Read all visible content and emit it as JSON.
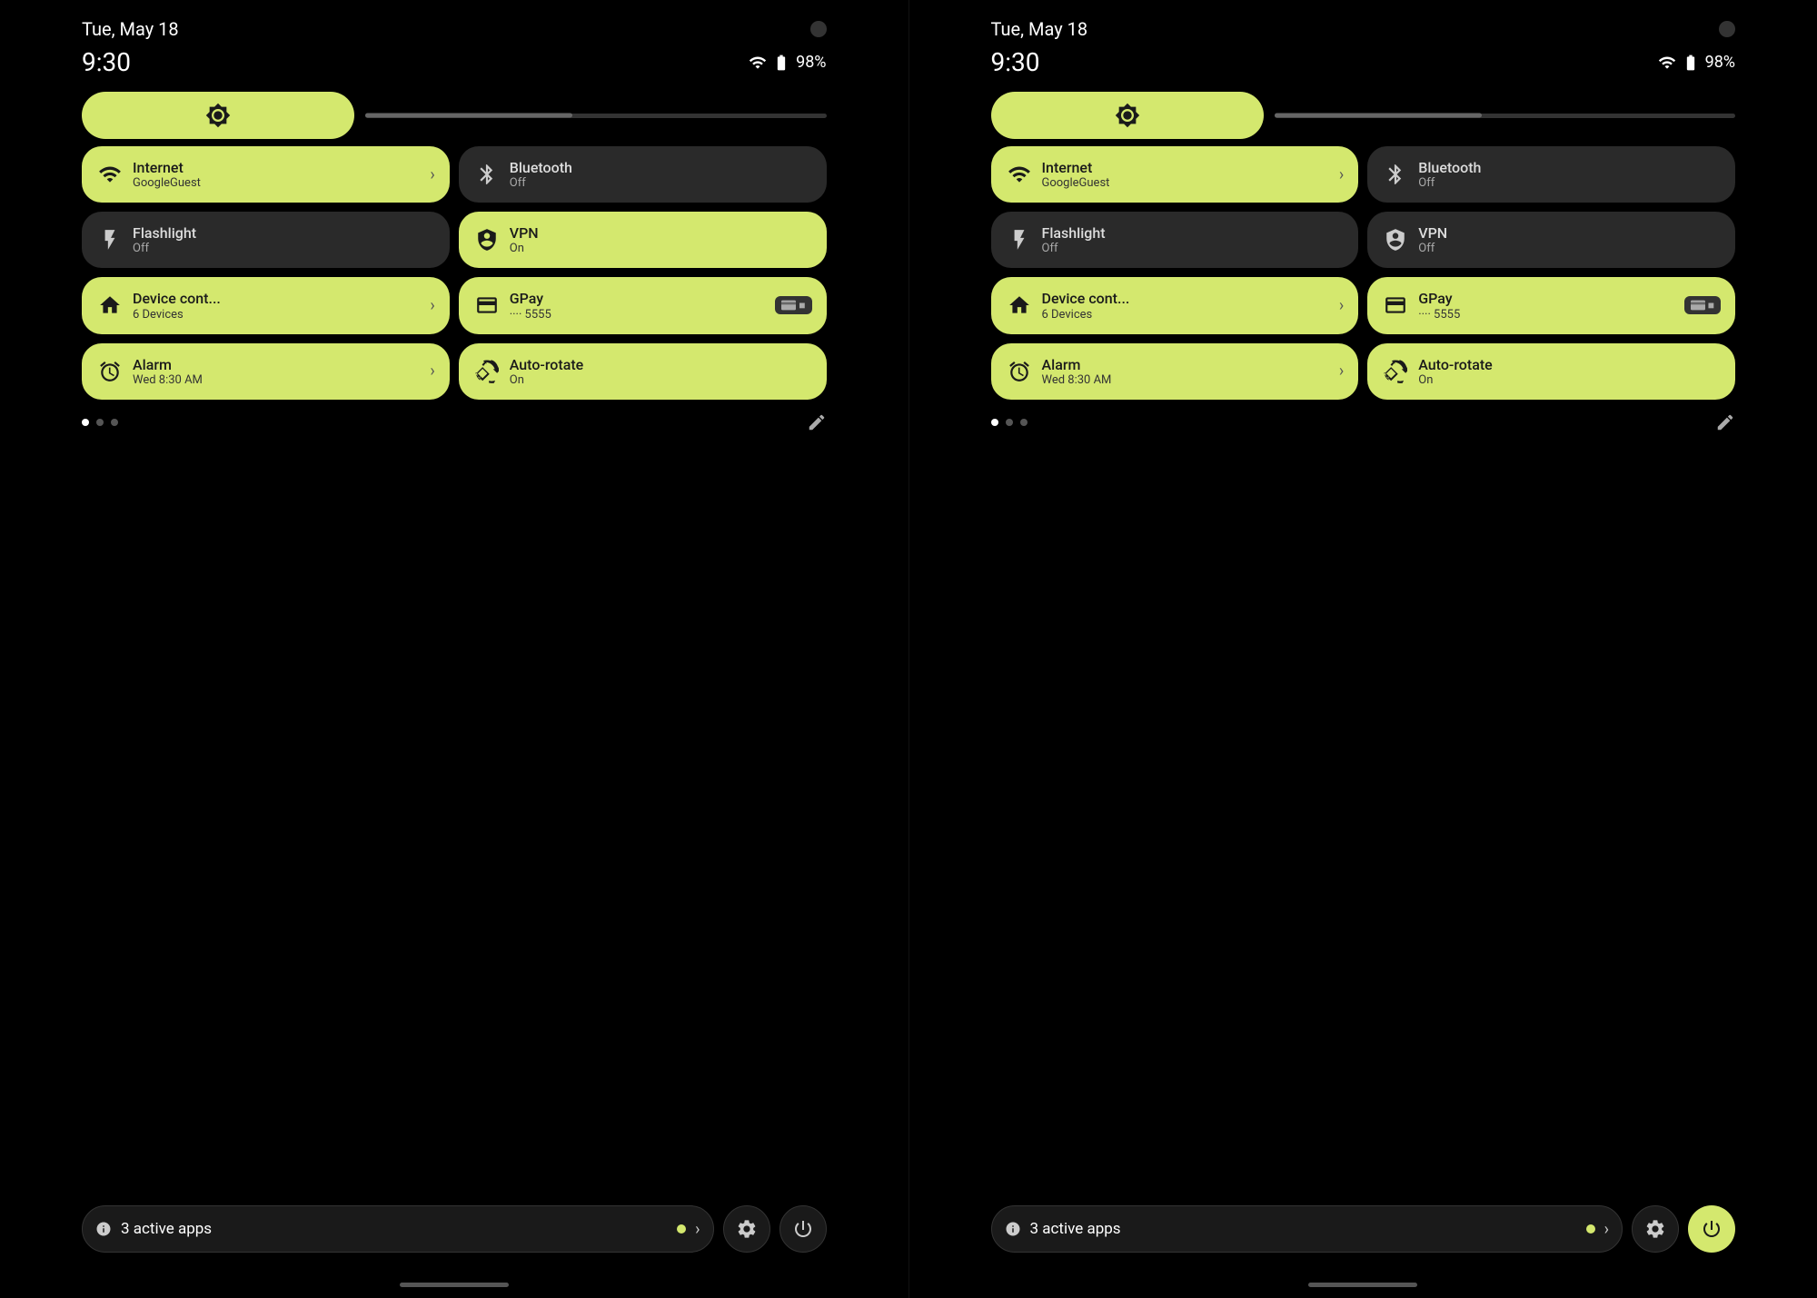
{
  "panels": [
    {
      "id": "left",
      "date": "Tue, May 18",
      "time": "9:30",
      "battery": "98%",
      "brightness_icon": "☀",
      "tiles": [
        {
          "id": "internet",
          "label": "Internet",
          "sublabel": "GoogleGuest",
          "icon": "wifi",
          "state": "active",
          "has_chevron": true
        },
        {
          "id": "bluetooth",
          "label": "Bluetooth",
          "sublabel": "Off",
          "icon": "bluetooth",
          "state": "inactive",
          "has_chevron": false
        },
        {
          "id": "flashlight",
          "label": "Flashlight",
          "sublabel": "Off",
          "icon": "flashlight",
          "state": "inactive",
          "has_chevron": false
        },
        {
          "id": "vpn",
          "label": "VPN",
          "sublabel": "On",
          "icon": "vpn",
          "state": "active",
          "has_chevron": false
        },
        {
          "id": "device-control",
          "label": "Device cont...",
          "sublabel": "6 Devices",
          "icon": "home",
          "state": "active",
          "has_chevron": true
        },
        {
          "id": "gpay",
          "label": "GPay",
          "sublabel": "···· 5555",
          "icon": "card",
          "state": "active",
          "has_chevron": false,
          "gpay": true
        },
        {
          "id": "alarm",
          "label": "Alarm",
          "sublabel": "Wed 8:30 AM",
          "icon": "alarm",
          "state": "active",
          "has_chevron": true
        },
        {
          "id": "autorotate",
          "label": "Auto-rotate",
          "sublabel": "On",
          "icon": "rotate",
          "state": "active",
          "has_chevron": false
        }
      ],
      "active_apps_label": "3 active apps",
      "settings_active": false,
      "power_active": false
    },
    {
      "id": "right",
      "date": "Tue, May 18",
      "time": "9:30",
      "battery": "98%",
      "brightness_icon": "☀",
      "tiles": [
        {
          "id": "internet",
          "label": "Internet",
          "sublabel": "GoogleGuest",
          "icon": "wifi",
          "state": "active",
          "has_chevron": true
        },
        {
          "id": "bluetooth",
          "label": "Bluetooth",
          "sublabel": "Off",
          "icon": "bluetooth",
          "state": "inactive",
          "has_chevron": false
        },
        {
          "id": "flashlight",
          "label": "Flashlight",
          "sublabel": "Off",
          "icon": "flashlight",
          "state": "inactive",
          "has_chevron": false
        },
        {
          "id": "vpn",
          "label": "VPN",
          "sublabel": "Off",
          "icon": "vpn",
          "state": "inactive",
          "has_chevron": false
        },
        {
          "id": "device-control",
          "label": "Device cont...",
          "sublabel": "6 Devices",
          "icon": "home",
          "state": "active",
          "has_chevron": true
        },
        {
          "id": "gpay",
          "label": "GPay",
          "sublabel": "···· 5555",
          "icon": "card",
          "state": "active",
          "has_chevron": false,
          "gpay": true
        },
        {
          "id": "alarm",
          "label": "Alarm",
          "sublabel": "Wed 8:30 AM",
          "icon": "alarm",
          "state": "active",
          "has_chevron": true
        },
        {
          "id": "autorotate",
          "label": "Auto-rotate",
          "sublabel": "On",
          "icon": "rotate",
          "state": "active",
          "has_chevron": false
        }
      ],
      "active_apps_label": "3 active apps",
      "settings_active": false,
      "power_active": true
    }
  ],
  "colors": {
    "active_tile": "#d4e86e",
    "inactive_tile": "#2a2a2a",
    "background": "#000000",
    "text_dark": "#1a1a1a",
    "text_light": "#ffffff"
  }
}
